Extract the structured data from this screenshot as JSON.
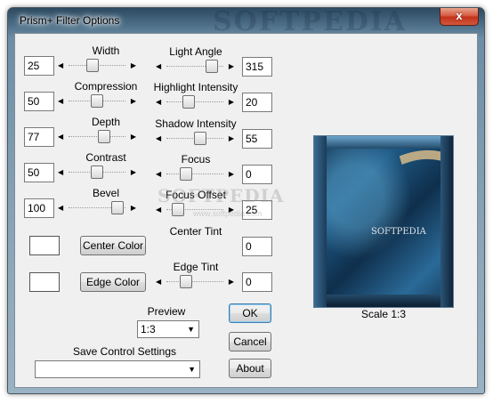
{
  "window": {
    "title": "Prism+ Filter Options",
    "close_glyph": "x"
  },
  "watermark": {
    "title": "SOFTPEDIA",
    "center": "SOFTPEDIA",
    "url": "www.softpedia.com",
    "preview": "SOFTPEDIA"
  },
  "left_controls": [
    {
      "label": "Width",
      "value": "25",
      "thumb": 0.4
    },
    {
      "label": "Compression",
      "value": "50",
      "thumb": 0.5
    },
    {
      "label": "Depth",
      "value": "77",
      "thumb": 0.65
    },
    {
      "label": "Contrast",
      "value": "50",
      "thumb": 0.5
    },
    {
      "label": "Bevel",
      "value": "100",
      "thumb": 0.95
    }
  ],
  "right_controls": [
    {
      "label": "Light Angle",
      "value": "315",
      "thumb": 0.88
    },
    {
      "label": "Highlight Intensity",
      "value": "20",
      "thumb": 0.35
    },
    {
      "label": "Shadow Intensity",
      "value": "55",
      "thumb": 0.62
    },
    {
      "label": "Focus",
      "value": "0",
      "thumb": 0.3
    },
    {
      "label": "Focus Offset",
      "value": "25",
      "thumb": 0.12
    },
    {
      "label": "Center Tint",
      "value": "0",
      "thumb": null
    },
    {
      "label": "Edge Tint",
      "value": "0",
      "thumb": 0.3
    }
  ],
  "color_buttons": {
    "center": "Center Color",
    "edge": "Edge Color"
  },
  "swatch_color": "#ffffff",
  "preview": {
    "label": "Preview",
    "selected": "1:3",
    "scale_label": "Scale 1:3"
  },
  "save_settings": {
    "label": "Save Control Settings",
    "selected": ""
  },
  "buttons": {
    "ok": "OK",
    "cancel": "Cancel",
    "about": "About"
  }
}
